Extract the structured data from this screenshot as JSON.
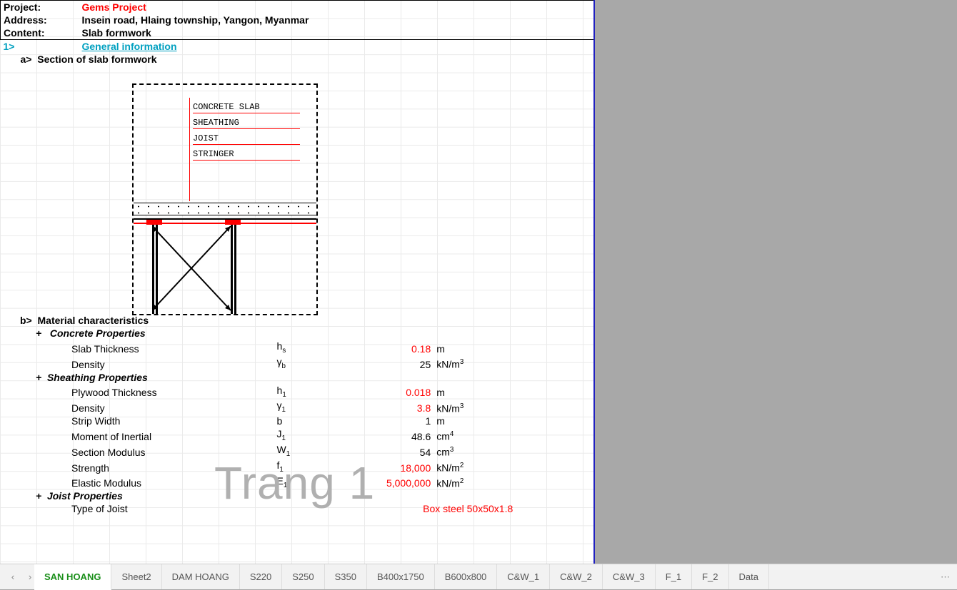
{
  "header": {
    "project_label": "Project:",
    "project_value": "Gems Project",
    "address_label": "Address:",
    "address_value": "Insein road, Hlaing township, Yangon, Myanmar",
    "content_label": "Content:",
    "content_value": "Slab formwork"
  },
  "sections": {
    "s1_num": "1>",
    "s1_title": "General information",
    "a_num": "a>",
    "a_title": "Section of slab formwork",
    "b_num": "b>",
    "b_title": "Material characteristics"
  },
  "diagram": {
    "l1": "CONCRETE SLAB",
    "l2": "SHEATHING",
    "l3": "JOIST",
    "l4": "STRINGER"
  },
  "groups": {
    "concrete": "Concrete Properties",
    "sheathing": "Sheathing Properties",
    "joist": "Joist Properties",
    "plus": "+"
  },
  "rows": {
    "slab_thick": {
      "label": "Slab Thickness",
      "sym": "h",
      "sub": "s",
      "val": "0.18",
      "unit": "m",
      "red": true
    },
    "density_b": {
      "label": "Density",
      "sym": "γ",
      "sub": "b",
      "val": "25",
      "unit": "kN/m",
      "sup": "3",
      "red": false
    },
    "ply_thick": {
      "label": "Plywood Thickness",
      "sym": "h",
      "sub": "1",
      "val": "0.018",
      "unit": "m",
      "red": true
    },
    "density_1": {
      "label": "Density",
      "sym": "γ",
      "sub": "1",
      "val": "3.8",
      "unit": "kN/m",
      "sup": "3",
      "red": true
    },
    "strip": {
      "label": "Strip Width",
      "sym": "b",
      "sub": "",
      "val": "1",
      "unit": "m",
      "red": false
    },
    "moi": {
      "label": "Moment of Inertial",
      "sym": "J",
      "sub": "1",
      "val": "48.6",
      "unit": "cm",
      "sup": "4",
      "red": false
    },
    "secmod": {
      "label": "Section Modulus",
      "sym": "W",
      "sub": "1",
      "val": "54",
      "unit": "cm",
      "sup": "3",
      "red": false
    },
    "strength": {
      "label": "Strength",
      "sym": "f",
      "sub": "1",
      "val": "18,000",
      "unit": "kN/m",
      "sup": "2",
      "red": true
    },
    "emod": {
      "label": "Elastic Modulus",
      "sym": "E",
      "sub": "1",
      "val": "5,000,000",
      "unit": "kN/m",
      "sup": "2",
      "red": true
    },
    "joist_type": {
      "label": "Type of Joist",
      "val": "Box steel 50x50x1.8"
    }
  },
  "watermark": "Trang 1",
  "tabs": [
    "SAN HOANG",
    "Sheet2",
    "DAM HOANG",
    "S220",
    "S250",
    "S350",
    "B400x1750",
    "B600x800",
    "C&W_1",
    "C&W_2",
    "C&W_3",
    "F_1",
    "F_2",
    "Data"
  ],
  "nav": {
    "prev": "‹",
    "next": "›",
    "more": "⋯"
  }
}
